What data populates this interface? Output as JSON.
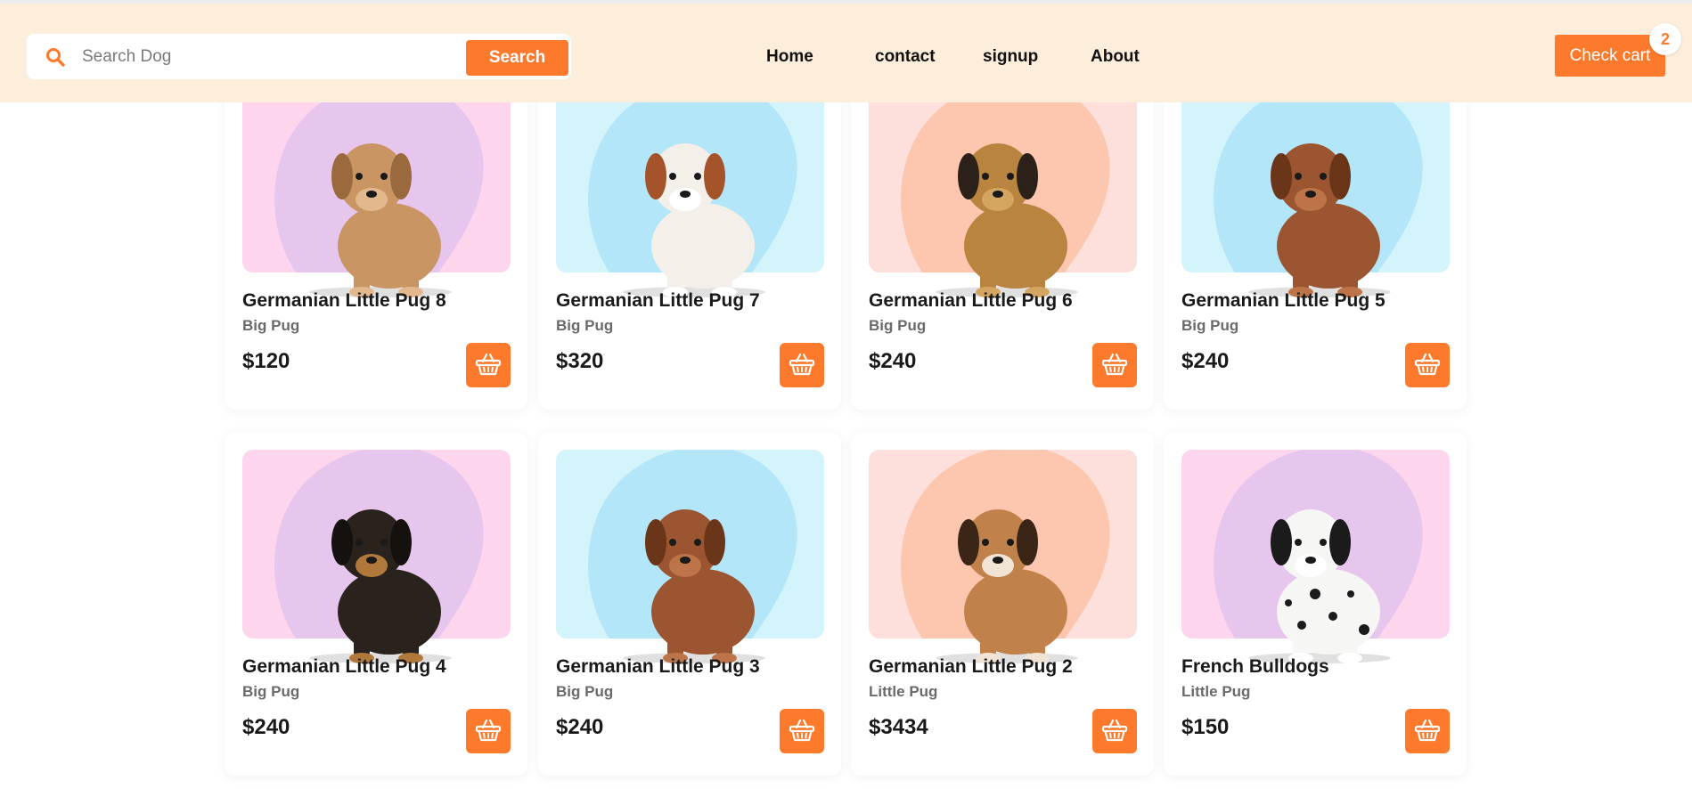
{
  "header": {
    "search": {
      "placeholder": "Search Dog",
      "value": "",
      "button_label": "Search"
    },
    "nav": [
      {
        "label": "Home"
      },
      {
        "label": "contact"
      },
      {
        "label": "signup"
      },
      {
        "label": "About"
      }
    ],
    "cart": {
      "label": "Check cart",
      "count": "2"
    }
  },
  "colors": {
    "accent": "#fd7a2c",
    "header_bg": "#fdeedb",
    "theme_purple": [
      "#fdd6ee",
      "#e7c6ee"
    ],
    "theme_blue": [
      "#d3f4fb",
      "#b3e6f8"
    ],
    "theme_peach": [
      "#fde0db",
      "#fdc6ae"
    ]
  },
  "products": [
    {
      "name": "Germanian Little Pug 8",
      "category": "Big Pug",
      "price": "$120",
      "image_theme": "purple",
      "breed_icon": "shar-pei-dog-photo"
    },
    {
      "name": "Germanian Little Pug 7",
      "category": "Big Pug",
      "price": "$320",
      "image_theme": "blue",
      "breed_icon": "spaniel-dog-photo"
    },
    {
      "name": "Germanian Little Pug 6",
      "category": "Big Pug",
      "price": "$240",
      "image_theme": "peach",
      "breed_icon": "shepherd-dog-photo"
    },
    {
      "name": "Germanian Little Pug 5",
      "category": "Big Pug",
      "price": "$240",
      "image_theme": "blue",
      "breed_icon": "mastiff-puppy-photo"
    },
    {
      "name": "Germanian Little Pug 4",
      "category": "Big Pug",
      "price": "$240",
      "image_theme": "purple",
      "breed_icon": "yorkie-puppy-photo"
    },
    {
      "name": "Germanian Little Pug 3",
      "category": "Big Pug",
      "price": "$240",
      "image_theme": "blue",
      "breed_icon": "mastiff-puppy-photo"
    },
    {
      "name": "Germanian Little Pug 2",
      "category": "Little Pug",
      "price": "$3434",
      "image_theme": "peach",
      "breed_icon": "boxer-puppy-photo"
    },
    {
      "name": "French Bulldogs",
      "category": "Little Pug",
      "price": "$150",
      "image_theme": "purple",
      "breed_icon": "dalmatian-dog-photo"
    }
  ]
}
